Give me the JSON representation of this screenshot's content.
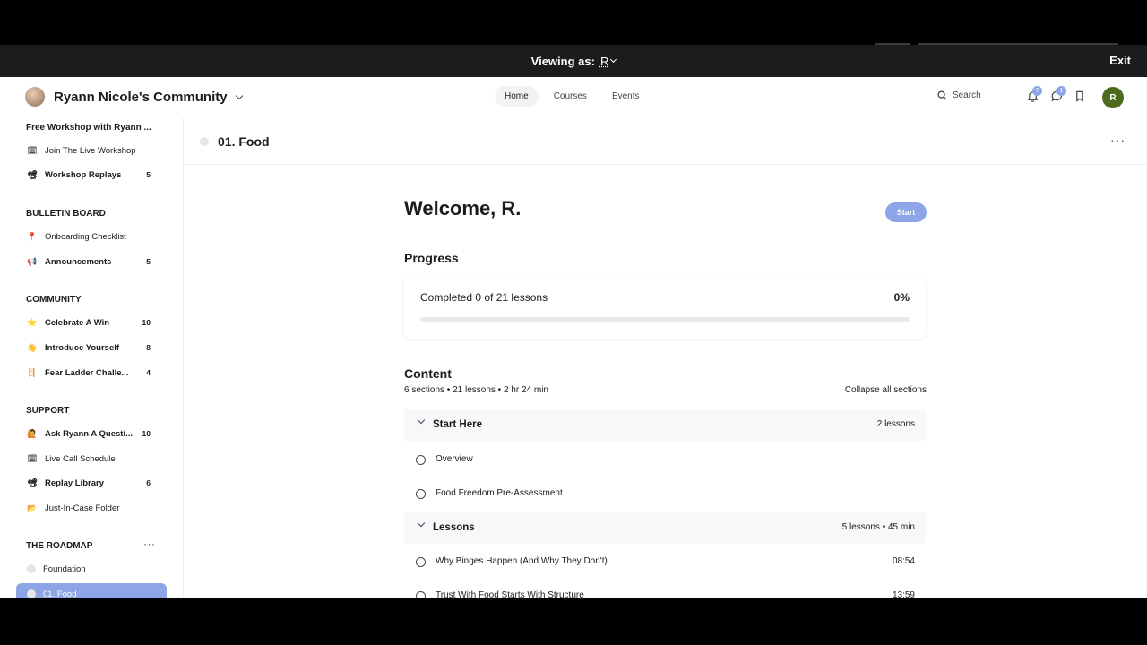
{
  "viewing_bar": {
    "label": "Viewing as:",
    "user": "R",
    "exit": "Exit"
  },
  "header": {
    "community_name": "Ryann Nicole's Community",
    "nav": [
      {
        "label": "Home",
        "active": true
      },
      {
        "label": "Courses",
        "active": false
      },
      {
        "label": "Events",
        "active": false
      }
    ],
    "search_label": "Search",
    "notification_badge": "7",
    "messages_badge": "1",
    "user_initial": "R"
  },
  "sidebar": {
    "group0_title": "Free Workshop with Ryann ...",
    "group0_items": [
      {
        "emoji": "🗓",
        "label": "Join The Live Workshop",
        "count": ""
      },
      {
        "emoji": "📽",
        "label": "Workshop Replays",
        "count": "5"
      }
    ],
    "group1_title": "BULLETIN BOARD",
    "group1_items": [
      {
        "emoji": "📍",
        "label": "Onboarding Checklist",
        "count": ""
      },
      {
        "emoji": "📢",
        "label": "Announcements",
        "count": "5"
      }
    ],
    "group2_title": "COMMUNITY",
    "group2_items": [
      {
        "emoji": "⭐",
        "label": "Celebrate A Win",
        "count": "10"
      },
      {
        "emoji": "👋",
        "label": "Introduce Yourself",
        "count": "8"
      },
      {
        "emoji": "🪜",
        "label": "Fear Ladder Challe...",
        "count": "4"
      }
    ],
    "group3_title": "SUPPORT",
    "group3_items": [
      {
        "emoji": "🙋",
        "label": "Ask Ryann A Questi...",
        "count": "10"
      },
      {
        "emoji": "🗓",
        "label": "Live Call Schedule",
        "count": ""
      },
      {
        "emoji": "📽",
        "label": "Replay Library",
        "count": "6"
      },
      {
        "emoji": "📂",
        "label": "Just-In-Case Folder",
        "count": ""
      }
    ],
    "group4_title": "THE ROADMAP",
    "group4_items": [
      {
        "label": "Foundation"
      },
      {
        "label": "01. Food"
      }
    ]
  },
  "page": {
    "title": "01. Food",
    "welcome": "Welcome, R.",
    "start_button": "Start",
    "progress_heading": "Progress",
    "progress_text": "Completed 0 of 21 lessons",
    "progress_percent": "0%",
    "progress_value": 0,
    "content_heading": "Content",
    "content_meta": "6 sections • 21 lessons • 2 hr 24 min",
    "collapse_label": "Collapse all sections",
    "sections": [
      {
        "title": "Start Here",
        "info": "2 lessons",
        "lessons": [
          {
            "title": "Overview",
            "duration": ""
          },
          {
            "title": "Food Freedom Pre-Assessment",
            "duration": ""
          }
        ]
      },
      {
        "title": "Lessons",
        "info": "5 lessons • 45 min",
        "lessons": [
          {
            "title": "Why Binges Happen (And Why They Don't)",
            "duration": "08:54"
          },
          {
            "title": "Trust With Food Starts With Structure",
            "duration": "13:59"
          }
        ]
      }
    ]
  },
  "colors": {
    "accent": "#8da5e6",
    "avatar": "#4d6b1f",
    "viewing_bar": "#1c1c1f"
  }
}
